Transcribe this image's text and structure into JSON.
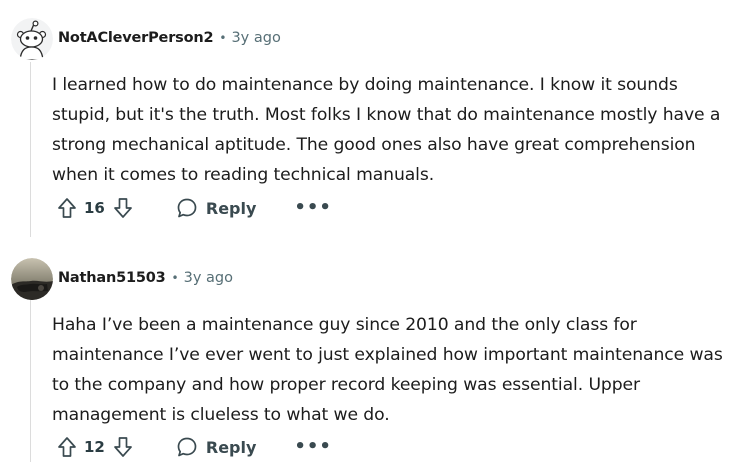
{
  "comments": [
    {
      "username": "NotACleverPerson2",
      "separator": "•",
      "age": "3y ago",
      "body": "I learned how to do maintenance by doing maintenance. I know it sounds stupid, but it's the truth. Most folks I know that do maintenance mostly have a strong mechanical aptitude. The good ones also have great comprehension when it comes to reading technical manuals.",
      "score": "16",
      "reply_label": "Reply",
      "more_label": "•••",
      "avatar_icon": "snoo-avatar-icon"
    },
    {
      "username": "Nathan51503",
      "separator": "•",
      "age": "3y ago",
      "body": "Haha I’ve been a maintenance guy since 2010 and the only class for maintenance I’ve ever went to just explained how important maintenance was to the company and how proper record keeping was essential. Upper management is clueless to what we do.",
      "score": "12",
      "reply_label": "Reply",
      "more_label": "•••",
      "avatar_icon": "photo-avatar-icon"
    }
  ],
  "colors": {
    "text": "#1c1c1c",
    "meta": "#576f76",
    "action": "#3a4a50",
    "thread_line": "#dcdcdc"
  }
}
